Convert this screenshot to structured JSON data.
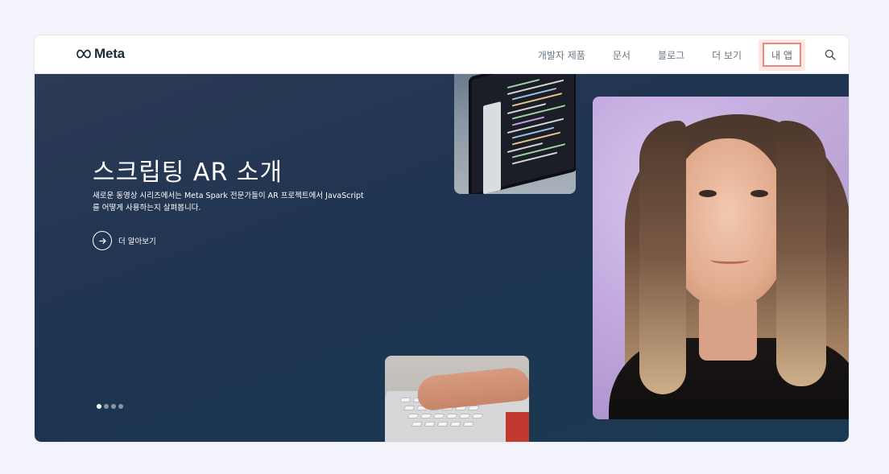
{
  "nav": {
    "logo_text": "Meta",
    "items": [
      {
        "label": "개발자 제품"
      },
      {
        "label": "문서"
      },
      {
        "label": "블로그"
      },
      {
        "label": "더 보기"
      }
    ],
    "my_apps_label": "내 앱",
    "search_icon": "search-icon"
  },
  "hero": {
    "title": "스크립팅 AR 소개",
    "description": "새로운 동영상 시리즈에서는 Meta Spark 전문가들이 AR 프로젝트에서 JavaScript를 어떻게 사용하는지 살펴봅니다.",
    "cta_label": "더 알아보기",
    "cta_icon": "arrow-right-icon",
    "carousel": {
      "total": 4,
      "active": 1
    }
  },
  "colors": {
    "page_bg": "#f3f3fb",
    "hero_bg": "#1e3450",
    "highlight_border": "#e9897e",
    "highlight_fill": "#fde8e6"
  }
}
